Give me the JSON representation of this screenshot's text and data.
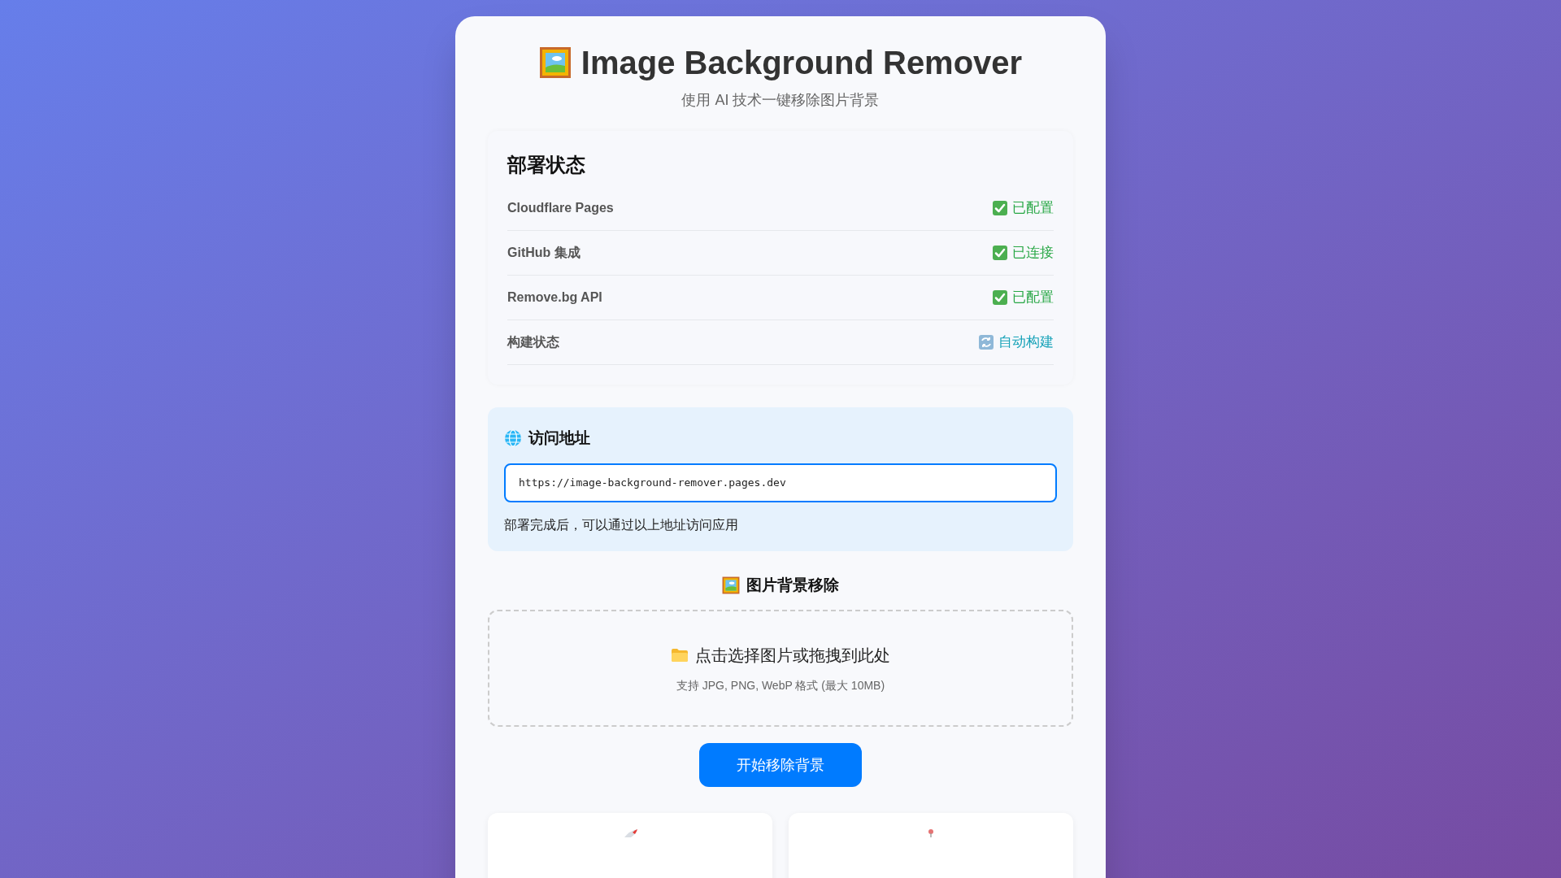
{
  "header": {
    "title": "Image Background Remover",
    "subtitle": "使用 AI 技术一键移除图片背景"
  },
  "deploy_status": {
    "title": "部署状态",
    "items": [
      {
        "label": "Cloudflare Pages",
        "status": "已配置",
        "kind": "ok"
      },
      {
        "label": "GitHub 集成",
        "status": "已连接",
        "kind": "ok"
      },
      {
        "label": "Remove.bg API",
        "status": "已配置",
        "kind": "ok"
      },
      {
        "label": "构建状态",
        "status": "自动构建",
        "kind": "sync"
      }
    ]
  },
  "access": {
    "title": "访问地址",
    "url": "https://image-background-remover.pages.dev",
    "note": "部署完成后，可以通过以上地址访问应用"
  },
  "remover": {
    "title": "图片背景移除",
    "drop_text": "点击选择图片或拖拽到此处",
    "drop_hint": "支持 JPG, PNG, WebP 格式 (最大 10MB)",
    "button": "开始移除背景"
  },
  "feature_cards": [
    {
      "kind": "rocket"
    },
    {
      "kind": "pin"
    }
  ]
}
